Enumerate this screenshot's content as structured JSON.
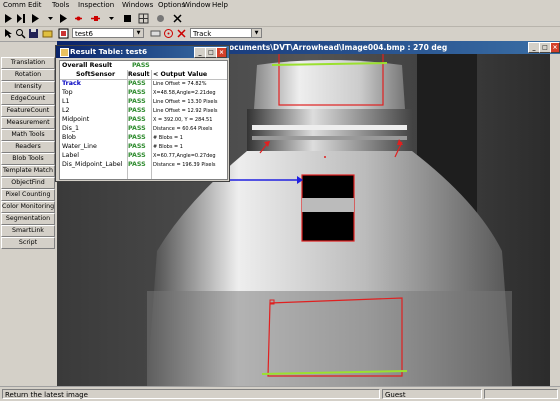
{
  "menu": {
    "items": [
      "Comm",
      "Edit",
      "Tools",
      "Inspection",
      "Windows",
      "Options",
      "Window",
      "Help"
    ]
  },
  "toolbar": {
    "inspection_select": "test6",
    "sensor_select": "Track"
  },
  "left_panel": {
    "buttons": [
      "Translation",
      "Rotation",
      "Intensity",
      "EdgeCount",
      "FeatureCount",
      "Measurement",
      "Math Tools",
      "Readers",
      "Blob Tools",
      "Template Match",
      "ObjectFind",
      "Pixel Counting",
      "Color Monitoring",
      "Segmentation",
      "SmartLink",
      "Script"
    ]
  },
  "image_window": {
    "title": "ocuments\\DVT\\Arrowhead\\Image004.bmp : 270 deg"
  },
  "result_table": {
    "title": "Result Table: test6",
    "overall_label": "Overall Result",
    "overall_value": "PASS",
    "col_softsensor": "SoftSensor",
    "col_result": "Result",
    "col_output": "Output Value",
    "rows": [
      {
        "name": "Track",
        "result": "PASS",
        "output": "Line Offset = 74.82%"
      },
      {
        "name": "Top",
        "result": "PASS",
        "output": "X=48.58,Angle=2.21deg"
      },
      {
        "name": "L1",
        "result": "PASS",
        "output": "Line Offset = 13.30 Pixels"
      },
      {
        "name": "L2",
        "result": "PASS",
        "output": "Line Offset = 12.92 Pixels"
      },
      {
        "name": "Midpoint",
        "result": "PASS",
        "output": "X = 392.00, Y = 284.51"
      },
      {
        "name": "Dis_1",
        "result": "PASS",
        "output": "Distance = 60.64 Pixels"
      },
      {
        "name": "Blob",
        "result": "PASS",
        "output": "# Blobs = 1"
      },
      {
        "name": "Water_Line",
        "result": "PASS",
        "output": "# Blobs = 1"
      },
      {
        "name": "Label",
        "result": "PASS",
        "output": "X=60.77,Angle=0.27deg"
      },
      {
        "name": "Dis_Midpoint_Label",
        "result": "PASS",
        "output": "Distance = 196.39 Pixels"
      }
    ]
  },
  "status": {
    "message": "Return the latest image",
    "user": "Guest"
  },
  "colors": {
    "pass": "#2e8b2e",
    "title_bar": "#0a246a",
    "overlay_red": "#e02020",
    "overlay_green": "#9be030",
    "arrow_blue": "#2020e0"
  }
}
